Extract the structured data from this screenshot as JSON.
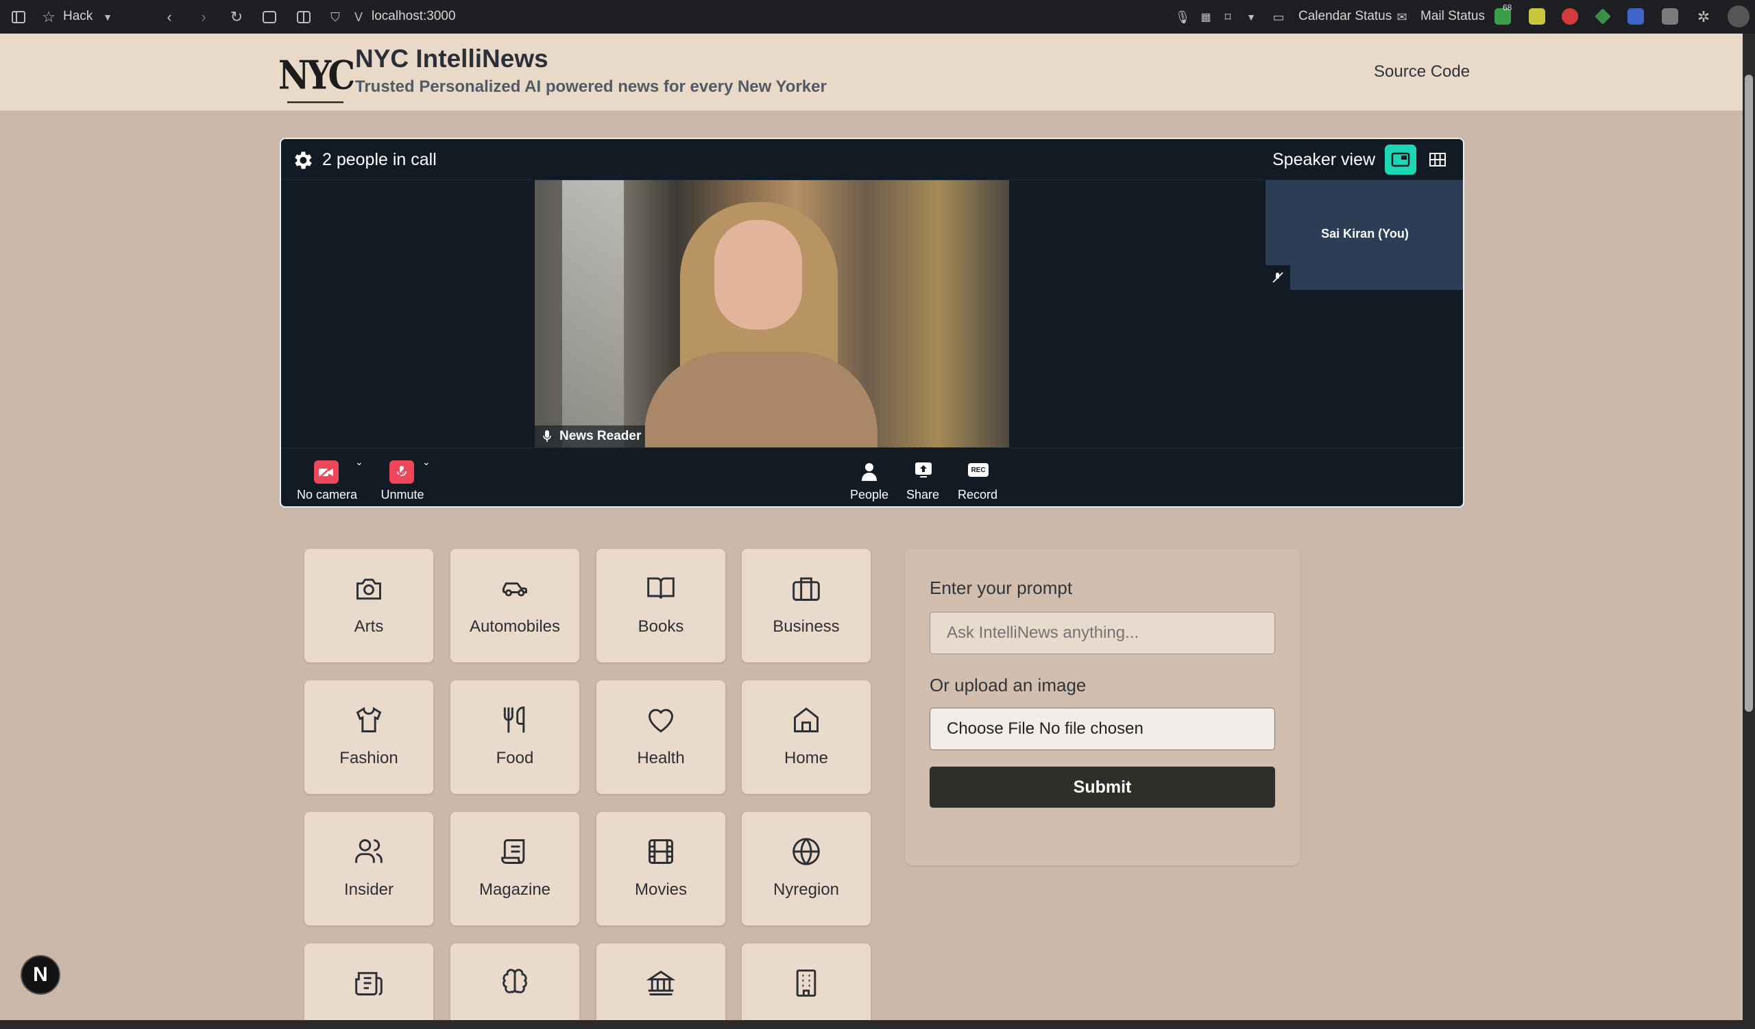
{
  "browser": {
    "profile": "Hack",
    "url": "localhost:3000",
    "calendar_status": "Calendar Status",
    "mail_status": "Mail Status",
    "badge_count": "68"
  },
  "header": {
    "logo_text": "NYC",
    "title": "NYC IntelliNews",
    "subtitle": "Trusted Personalized AI powered news for every New Yorker",
    "source_link": "Source Code"
  },
  "call": {
    "people_count": "2 people in call",
    "view_label": "Speaker view",
    "main_speaker": "News Reader",
    "self_name": "Sai Kiran (You)",
    "tray": {
      "camera": "No camera",
      "mic": "Unmute",
      "people": "People",
      "share": "Share",
      "record": "Record",
      "rec_badge": "REC"
    }
  },
  "categories": [
    {
      "label": "Arts",
      "icon": "camera-icon"
    },
    {
      "label": "Automobiles",
      "icon": "car-icon"
    },
    {
      "label": "Books",
      "icon": "book-icon"
    },
    {
      "label": "Business",
      "icon": "briefcase-icon"
    },
    {
      "label": "Fashion",
      "icon": "shirt-icon"
    },
    {
      "label": "Food",
      "icon": "utensils-icon"
    },
    {
      "label": "Health",
      "icon": "heart-icon"
    },
    {
      "label": "Home",
      "icon": "house-icon"
    },
    {
      "label": "Insider",
      "icon": "users-icon"
    },
    {
      "label": "Magazine",
      "icon": "scroll-icon"
    },
    {
      "label": "Movies",
      "icon": "film-icon"
    },
    {
      "label": "Nyregion",
      "icon": "globe-icon"
    }
  ],
  "prompt": {
    "label": "Enter your prompt",
    "placeholder": "Ask IntelliNews anything...",
    "upload_label": "Or upload an image",
    "file_button": "Choose File",
    "file_status": "No file chosen",
    "submit": "Submit"
  },
  "next_badge": "N",
  "colors": {
    "page_bg": "#cbb8a9",
    "header_bg": "#e8d9c8",
    "call_bg": "#121a24",
    "accent_teal": "#1ed6b4",
    "mute_red": "#f0465a",
    "submit_bg": "#2f2e2b"
  }
}
